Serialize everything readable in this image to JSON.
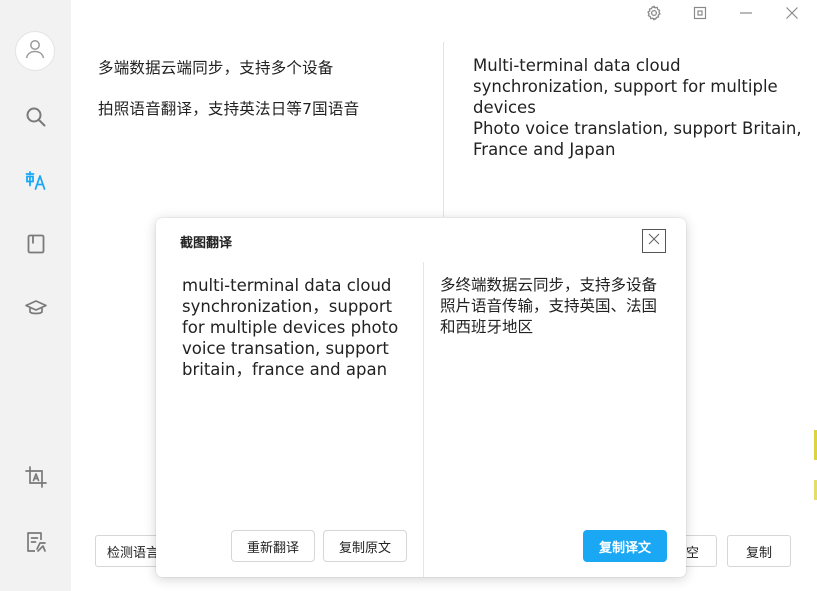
{
  "sidebar": {
    "items": [
      {
        "icon": "avatar-user-icon"
      },
      {
        "icon": "search-icon"
      },
      {
        "icon": "translate-icon",
        "active": true
      },
      {
        "icon": "notebook-icon"
      },
      {
        "icon": "graduation-cap-icon"
      },
      {
        "icon": "screenshot-translate-icon"
      },
      {
        "icon": "document-translate-icon"
      }
    ],
    "active_color": "#1aa8f5"
  },
  "window_controls": [
    "gear-icon",
    "restore-icon",
    "minimize-icon",
    "close-icon"
  ],
  "main": {
    "source_lines": [
      "多端数据云端同步，支持多个设备",
      "拍照语音翻译，支持英法日等7国语音"
    ],
    "target_paragraphs": [
      "Multi-terminal data cloud synchronization, support for multiple devices",
      "Photo voice translation, support Britain, France and Japan"
    ],
    "detect_language_label": "检测语言",
    "clear_label_partial": "空",
    "copy_label": "复制"
  },
  "dialog": {
    "title": "截图翻译",
    "source_text": "multi-terminal data cloud synchronization，support for multiple devices  photo voice transation, support britain，france and apan",
    "translated_text": "多终端数据云同步，支持多设备照片语音传输，支持英国、法国和西班牙地区",
    "retranslate_label": "重新翻译",
    "copy_original_label": "复制原文",
    "copy_translation_label": "复制译文",
    "primary_color": "#1aa8f5"
  }
}
